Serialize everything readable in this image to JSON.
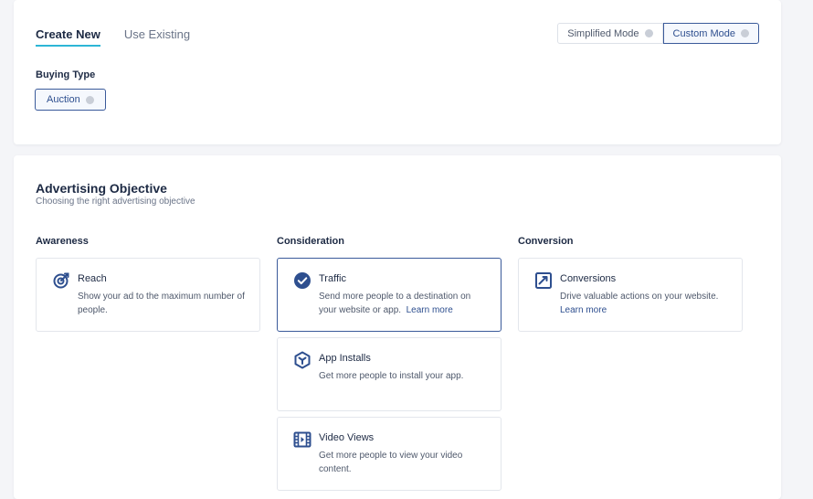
{
  "tabs": {
    "create_new": "Create New",
    "use_existing": "Use Existing"
  },
  "modes": {
    "simplified": "Simplified Mode",
    "custom": "Custom Mode"
  },
  "buying_type": {
    "label": "Buying Type",
    "value": "Auction"
  },
  "objective": {
    "title": "Advertising Objective",
    "subtitle": "Choosing the right advertising objective",
    "columns": {
      "awareness": "Awareness",
      "consideration": "Consideration",
      "conversion": "Conversion"
    },
    "cards": {
      "reach": {
        "title": "Reach",
        "desc": "Show your ad to the maximum number of people."
      },
      "traffic": {
        "title": "Traffic",
        "desc_line1": "Send more people to a destination on",
        "desc_line2": "your website or app.",
        "link": "Learn more"
      },
      "conversions": {
        "title": "Conversions",
        "desc": "Drive valuable actions on your website.",
        "link": "Learn more"
      },
      "app_installs": {
        "title": "App Installs",
        "desc": "Get more people to install your app."
      },
      "video_views": {
        "title": "Video Views",
        "desc": "Get more people to view your video content."
      }
    }
  },
  "colors": {
    "accent": "#2e4f8f",
    "tab_underline": "#2db6d6",
    "selected_border": "#3a5a9a"
  }
}
